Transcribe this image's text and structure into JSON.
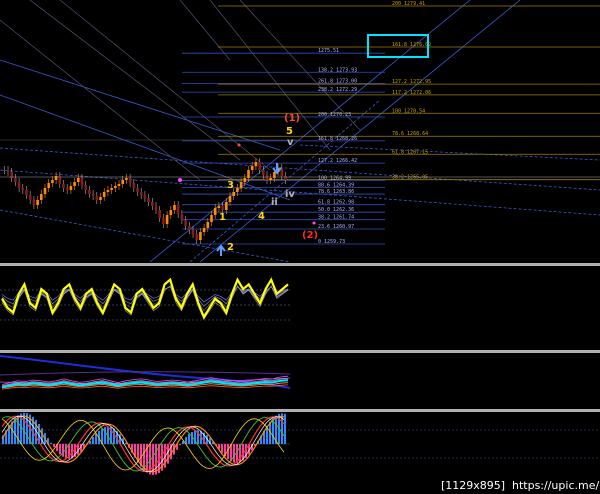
{
  "chart_data": [
    {
      "type": "line",
      "panel": "price",
      "fib_levels": [
        {
          "label": "200 1279.41",
          "price": 1279.41,
          "color": "#c8a000"
        },
        {
          "label": "161.8 1276.02",
          "price": 1276.02,
          "color": "#c8a000"
        },
        {
          "label": "1275.51",
          "price": 1275.51,
          "color": "#b0b0ff"
        },
        {
          "label": "138.2 1273.93",
          "price": 1273.93,
          "color": "#b0b0ff"
        },
        {
          "label": "261.8 1273.00",
          "price": 1273.0,
          "color": "#b0b0ff"
        },
        {
          "label": "127.2 1272.95",
          "price": 1272.95,
          "color": "#c8a000"
        },
        {
          "label": "238.2 1272.29",
          "price": 1272.29,
          "color": "#b0b0ff"
        },
        {
          "label": "117.2 1272.06",
          "price": 1272.06,
          "color": "#c8a000"
        },
        {
          "label": "100 1270.54",
          "price": 1270.54,
          "color": "#c8a000"
        },
        {
          "label": "200 1270.23",
          "price": 1270.23,
          "color": "#b0b0ff"
        },
        {
          "label": "78.6 1268.64",
          "price": 1268.64,
          "color": "#c8a000"
        },
        {
          "label": "161.8 1268.26",
          "price": 1268.26,
          "color": "#b0b0ff"
        },
        {
          "label": "61.8 1267.15",
          "price": 1267.15,
          "color": "#c8a000"
        },
        {
          "label": "127.2 1266.42",
          "price": 1266.42,
          "color": "#b0b0ff"
        },
        {
          "label": "38.2 1265.05",
          "price": 1265.05,
          "color": "#c8a000"
        },
        {
          "label": "100 1264.99",
          "price": 1264.99,
          "color": "#b0b0ff"
        },
        {
          "label": "88.6 1264.39",
          "price": 1264.39,
          "color": "#b0b0ff"
        },
        {
          "label": "78.6 1263.86",
          "price": 1263.86,
          "color": "#b0b0ff"
        },
        {
          "label": "61.8 1262.98",
          "price": 1262.98,
          "color": "#b0b0ff"
        },
        {
          "label": "50.0 1262.36",
          "price": 1262.36,
          "color": "#b0b0ff"
        },
        {
          "label": "38.2 1261.74",
          "price": 1261.74,
          "color": "#b0b0ff"
        },
        {
          "label": "23.6 1260.97",
          "price": 1260.97,
          "color": "#b0b0ff"
        },
        {
          "label": "0 1259.73",
          "price": 1259.73,
          "color": "#b0b0ff"
        }
      ],
      "wave_labels": [
        {
          "text": "(1)",
          "color": "#ff4a1a"
        },
        {
          "text": "5",
          "color": "#ffd800"
        },
        {
          "text": "3",
          "color": "#ffd800"
        },
        {
          "text": "1",
          "color": "#ffd800"
        },
        {
          "text": "4",
          "color": "#ffd800"
        },
        {
          "text": "2",
          "color": "#ffd800"
        },
        {
          "text": "(2)",
          "color": "#ff2a2a"
        },
        {
          "text": "iv",
          "color": "#b0b0b0"
        },
        {
          "text": "ii",
          "color": "#b0b0b0"
        },
        {
          "text": "v",
          "color": "#b0b0b0"
        }
      ],
      "current_price_label": "38.2 1265.05"
    },
    {
      "type": "line",
      "panel": "oscillator-1",
      "series": [
        {
          "color": "#ffff00",
          "values": [
            0.5,
            0.3,
            0.2,
            0.6,
            0.8,
            0.4,
            0.3,
            0.7,
            0.6,
            0.2,
            0.4,
            0.7,
            0.8,
            0.5,
            0.3,
            0.6,
            0.7,
            0.4,
            0.2,
            0.5,
            0.8,
            0.7,
            0.3,
            0.2,
            0.6,
            0.7,
            0.5,
            0.3,
            0.4,
            0.8,
            0.9,
            0.5,
            0.3,
            0.6,
            0.8,
            0.4,
            0.1,
            0.3,
            0.5,
            0.4,
            0.2,
            0.6,
            0.9,
            0.7,
            0.8,
            0.6,
            0.4,
            0.7,
            0.9,
            0.6,
            0.7,
            0.8
          ]
        }
      ]
    },
    {
      "type": "line",
      "panel": "oscillator-2",
      "series": [
        {
          "color": "#00e0ff",
          "values": [
            0.4,
            0.45,
            0.5,
            0.48,
            0.52,
            0.5,
            0.47,
            0.5,
            0.55,
            0.5,
            0.46,
            0.48,
            0.52,
            0.55,
            0.5,
            0.45,
            0.5,
            0.53,
            0.55,
            0.52,
            0.48,
            0.5,
            0.52,
            0.5,
            0.47,
            0.5,
            0.54,
            0.58,
            0.55,
            0.52,
            0.5,
            0.48,
            0.5,
            0.53,
            0.56,
            0.55,
            0.6,
            0.62
          ]
        }
      ]
    },
    {
      "type": "bar",
      "panel": "histogram",
      "series": [
        {
          "name": "pos",
          "color": "#2a8cff"
        },
        {
          "name": "neg",
          "color": "#ff3aa0"
        }
      ]
    }
  ],
  "footer": {
    "resolution": "[1129x895]",
    "url": "https://upic.me/"
  }
}
